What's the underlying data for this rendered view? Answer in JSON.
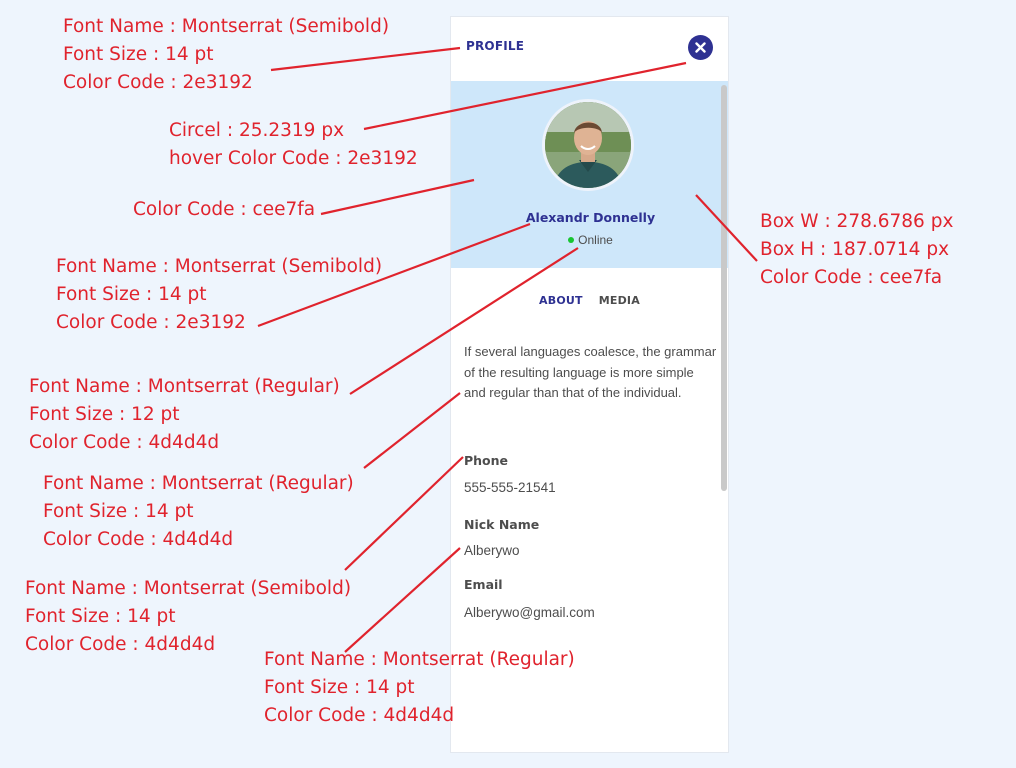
{
  "profile": {
    "title": "PROFILE",
    "close_icon": "close-icon",
    "user_name": "Alexandr Donnelly",
    "status": "Online",
    "status_color": "#18c531",
    "tabs": [
      "ABOUT",
      "MEDIA"
    ],
    "active_tab": "ABOUT",
    "about": "If several languages coalesce, the grammar of the resulting language is more simple and regular than that of the individual.",
    "fields": [
      {
        "label": "Phone",
        "value": "555-555-21541"
      },
      {
        "label": "Nick Name",
        "value": "Alberywo"
      },
      {
        "label": "Email",
        "value": "Alberywo@gmail.com"
      }
    ]
  },
  "annotations": {
    "title_spec": [
      "Font Name : Montserrat (Semibold)",
      "Font Size : 14 pt",
      "Color Code : 2e3192"
    ],
    "circle_spec": [
      "Circel : 25.2319  px",
      " hover Color Code : 2e3192"
    ],
    "cover_color": "Color Code : cee7fa",
    "box_spec": [
      "Box W : 278.6786 px",
      "Box H : 187.0714 px",
      "Color Code : cee7fa"
    ],
    "name_spec": [
      "Font Name : Montserrat (Semibold)",
      "Font Size : 14 pt",
      "Color Code : 2e3192"
    ],
    "status_spec": [
      "Font Name : Montserrat (Regular)",
      "Font Size : 12 pt",
      "Color Code : 4d4d4d"
    ],
    "about_spec": [
      "Font Name : Montserrat (Regular)",
      "Font Size : 14 pt",
      "Color Code : 4d4d4d"
    ],
    "label_spec": [
      "Font Name : Montserrat (Semibold)",
      "Font Size : 14 pt",
      "Color Code : 4d4d4d"
    ],
    "value_spec": [
      "Font Name : Montserrat (Regular)",
      "Font Size : 14 pt",
      "Color Code : 4d4d4d"
    ]
  },
  "colors": {
    "primary": "#2e3192",
    "cover": "#cee7fa",
    "text": "#4d4d4d",
    "annotation": "#e0232d",
    "background": "#eef5fd"
  }
}
